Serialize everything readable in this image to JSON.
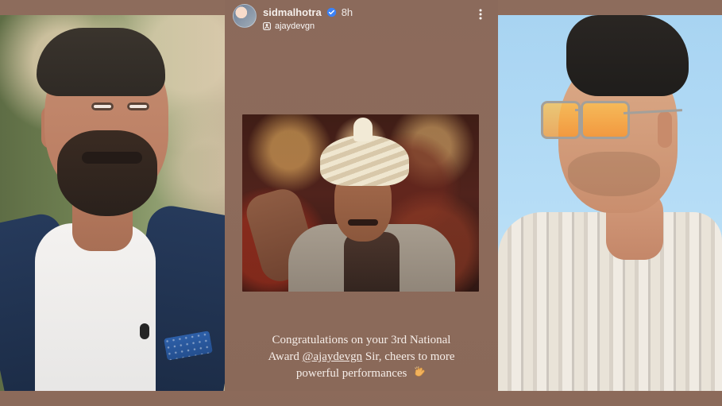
{
  "story": {
    "username": "sidmalhotra",
    "timestamp": "8h",
    "mentioned_account": "ajaydevgn",
    "caption": {
      "line1": "Congratulations on your 3rd National",
      "line2_prefix": "Award ",
      "line2_handle": "@ajaydevgn",
      "line2_suffix": " Sir, cheers to more",
      "line3": "powerful performances"
    }
  },
  "colors": {
    "background": "#8f6e5e",
    "story_background": "#8b6a5b",
    "text": "#f5efeb",
    "verified_badge": "#3b82f6"
  },
  "icons": {
    "verified": "verified-badge-icon",
    "mention": "person-tag-icon",
    "more": "more-vertical-icon",
    "clap": "clap-emoji-icon"
  }
}
